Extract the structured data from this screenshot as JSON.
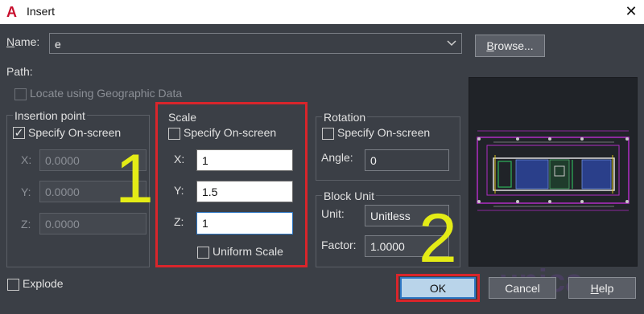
{
  "window": {
    "title": "Insert",
    "logo_letter": "A",
    "close": "✕"
  },
  "name_row": {
    "label": "Name:",
    "value": "e",
    "browse_label": "Browse..."
  },
  "path": {
    "label": "Path:"
  },
  "geo": {
    "label": "Locate using Geographic Data"
  },
  "insertion": {
    "title": "Insertion point",
    "specify": "Specify On-screen",
    "x_label": "X:",
    "x_value": "0.0000",
    "y_label": "Y:",
    "y_value": "0.0000",
    "z_label": "Z:",
    "z_value": "0.0000"
  },
  "scale": {
    "title": "Scale",
    "specify": "Specify On-screen",
    "x_label": "X:",
    "x_value": "1",
    "y_label": "Y:",
    "y_value": "1.5",
    "z_label": "Z:",
    "z_value": "1",
    "uniform": "Uniform Scale"
  },
  "rotation": {
    "title": "Rotation",
    "specify": "Specify On-screen",
    "angle_label": "Angle:",
    "angle_value": "0"
  },
  "block_unit": {
    "title": "Block Unit",
    "unit_label": "Unit:",
    "unit_value": "Unitless",
    "factor_label": "Factor:",
    "factor_value": "1.0000"
  },
  "explode": {
    "label": "Explode"
  },
  "buttons": {
    "ok": "OK",
    "cancel": "Cancel",
    "help": "Help"
  },
  "annotations": {
    "one": "1",
    "two": "2"
  },
  "watermark": "unica",
  "colors": {
    "accent": "#d9252b",
    "annotation": "#e4ec16",
    "ok_border": "#2f78c4"
  }
}
